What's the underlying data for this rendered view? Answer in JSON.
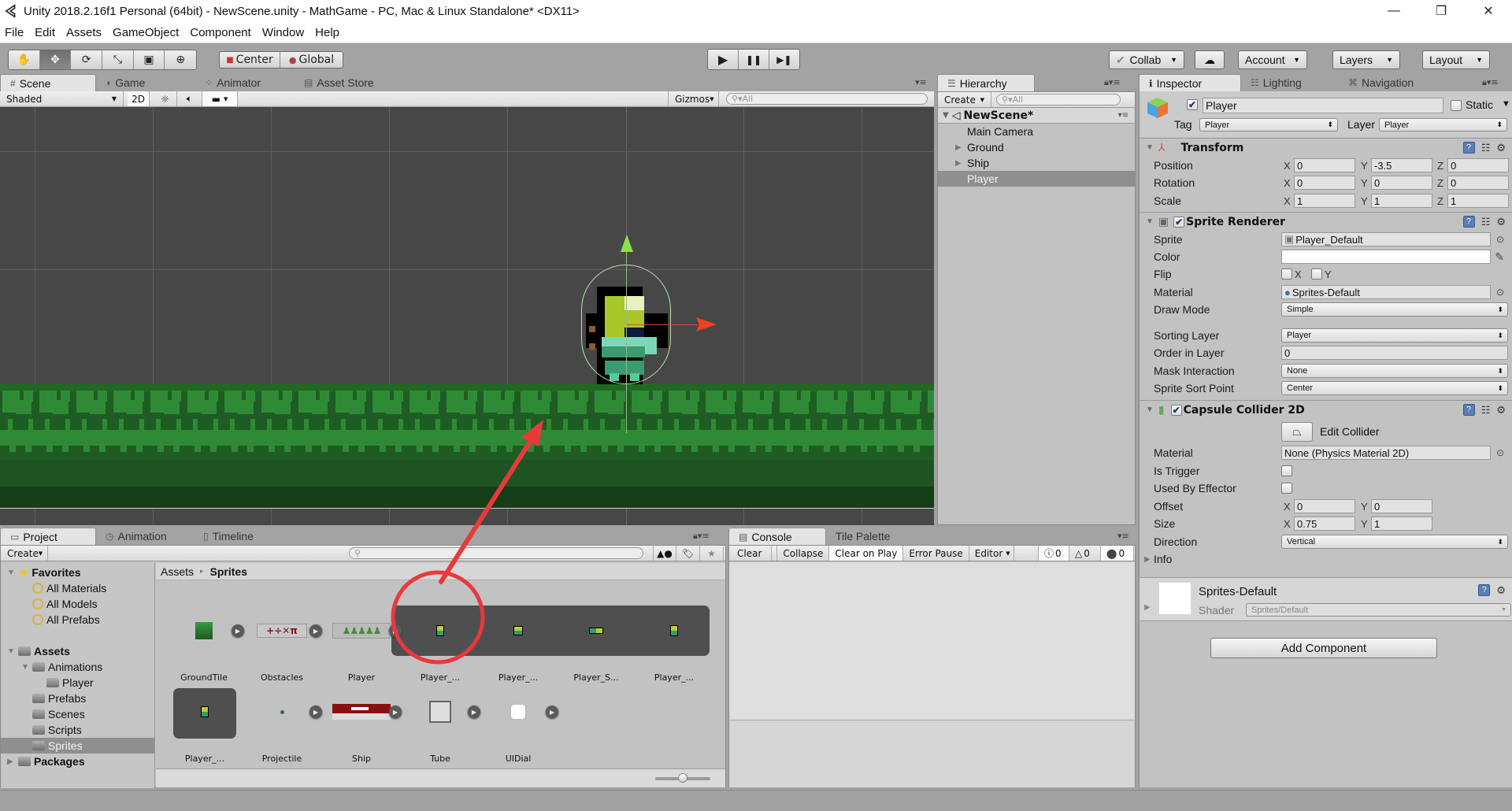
{
  "window": {
    "title": "Unity 2018.2.16f1 Personal (64bit) - NewScene.unity - MathGame - PC, Mac & Linux Standalone* <DX11>",
    "minimize": "—",
    "maximize": "❐",
    "close": "✕"
  },
  "menu": [
    "File",
    "Edit",
    "Assets",
    "GameObject",
    "Component",
    "Window",
    "Help"
  ],
  "toolbar": {
    "tools": [
      {
        "name": "hand-tool",
        "glyph": "✋",
        "active": false
      },
      {
        "name": "move-tool",
        "glyph": "✥",
        "active": true
      },
      {
        "name": "rotate-tool",
        "glyph": "⟳",
        "active": false
      },
      {
        "name": "scale-tool",
        "glyph": "⤡",
        "active": false
      },
      {
        "name": "rect-tool",
        "glyph": "▣",
        "active": false
      },
      {
        "name": "transform-tool",
        "glyph": "⊕",
        "active": false
      }
    ],
    "pivot": "Center",
    "space": "Global",
    "play": "▶",
    "pause": "❚❚",
    "step": "▶❚",
    "collab": "Collab",
    "cloud": "☁",
    "account": "Account",
    "layers": "Layers",
    "layout": "Layout"
  },
  "scene_tabs": [
    {
      "label": "Scene",
      "icon": "#",
      "active": true
    },
    {
      "label": "Game",
      "icon": "◖",
      "active": false
    },
    {
      "label": "Animator",
      "icon": "⁘",
      "active": false
    },
    {
      "label": "Asset Store",
      "icon": "▤",
      "active": false
    }
  ],
  "scene_toolbar": {
    "shading": "Shaded",
    "mode2d": "2D",
    "gizmos": "Gizmos",
    "search_placeholder": "All"
  },
  "hierarchy": {
    "tab": "Hierarchy",
    "create": "Create",
    "search_placeholder": "All",
    "scene": "NewScene*",
    "items": [
      {
        "label": "Main Camera",
        "expandable": false,
        "selected": false
      },
      {
        "label": "Ground",
        "expandable": true,
        "selected": false
      },
      {
        "label": "Ship",
        "expandable": true,
        "selected": false
      },
      {
        "label": "Player",
        "expandable": false,
        "selected": true
      }
    ]
  },
  "inspector": {
    "tabs": [
      {
        "label": "Inspector",
        "icon": "ℹ",
        "active": true
      },
      {
        "label": "Lighting",
        "icon": "☷",
        "active": false
      },
      {
        "label": "Navigation",
        "icon": "⌘",
        "active": false
      }
    ],
    "object": {
      "active": true,
      "name": "Player",
      "static_label": "Static",
      "static": false,
      "tag_label": "Tag",
      "tag": "Player",
      "layer_label": "Layer",
      "layer": "Player"
    },
    "transform": {
      "title": "Transform",
      "position": {
        "label": "Position",
        "x": "0",
        "y": "-3.5",
        "z": "0"
      },
      "rotation": {
        "label": "Rotation",
        "x": "0",
        "y": "0",
        "z": "0"
      },
      "scale": {
        "label": "Scale",
        "x": "1",
        "y": "1",
        "z": "1"
      }
    },
    "sprite_renderer": {
      "title": "Sprite Renderer",
      "enabled": true,
      "sprite_label": "Sprite",
      "sprite": "Player_Default",
      "color_label": "Color",
      "color": "#ffffff",
      "flip_label": "Flip",
      "flip_x": false,
      "flip_y": false,
      "material_label": "Material",
      "material": "Sprites-Default",
      "draw_mode_label": "Draw Mode",
      "draw_mode": "Simple",
      "sorting_layer_label": "Sorting Layer",
      "sorting_layer": "Player",
      "order_label": "Order in Layer",
      "order": "0",
      "mask_label": "Mask Interaction",
      "mask": "None",
      "sort_point_label": "Sprite Sort Point",
      "sort_point": "Center"
    },
    "capsule_collider": {
      "title": "Capsule Collider 2D",
      "enabled": true,
      "edit_collider": "Edit Collider",
      "material_label": "Material",
      "material": "None (Physics Material 2D)",
      "is_trigger_label": "Is Trigger",
      "is_trigger": false,
      "effector_label": "Used By Effector",
      "effector": false,
      "offset_label": "Offset",
      "offset": {
        "x": "0",
        "y": "0"
      },
      "size_label": "Size",
      "size": {
        "x": "0.75",
        "y": "1"
      },
      "direction_label": "Direction",
      "direction": "Vertical",
      "info_label": "Info"
    },
    "material_preview": {
      "name": "Sprites-Default",
      "shader_label": "Shader",
      "shader": "Sprites/Default"
    },
    "add_component": "Add Component"
  },
  "project": {
    "tabs": [
      {
        "label": "Project",
        "icon": "▭",
        "active": true
      },
      {
        "label": "Animation",
        "icon": "◷",
        "active": false
      },
      {
        "label": "Timeline",
        "icon": "▯",
        "active": false
      }
    ],
    "create": "Create",
    "search_placeholder": "",
    "tree": [
      {
        "label": "Favorites",
        "type": "star",
        "level": 0,
        "bold": true,
        "expanded": true
      },
      {
        "label": "All Materials",
        "type": "search",
        "level": 1
      },
      {
        "label": "All Models",
        "type": "search",
        "level": 1
      },
      {
        "label": "All Prefabs",
        "type": "search",
        "level": 1
      },
      {
        "label": "Assets",
        "type": "folder",
        "level": 0,
        "bold": true,
        "expanded": true
      },
      {
        "label": "Animations",
        "type": "folder",
        "level": 1,
        "expanded": true
      },
      {
        "label": "Player",
        "type": "folder",
        "level": 2
      },
      {
        "label": "Prefabs",
        "type": "folder",
        "level": 1
      },
      {
        "label": "Scenes",
        "type": "folder",
        "level": 1
      },
      {
        "label": "Scripts",
        "type": "folder",
        "level": 1
      },
      {
        "label": "Sprites",
        "type": "folder",
        "level": 1,
        "selected": true
      },
      {
        "label": "Packages",
        "type": "folder",
        "level": 0,
        "bold": true,
        "expanded": false
      }
    ],
    "breadcrumb": {
      "root": "Assets",
      "separator": "▸",
      "current": "Sprites"
    },
    "assets_row1": [
      {
        "label": "GroundTile",
        "kind": "groundtile"
      },
      {
        "label": "Obstacles",
        "kind": "obstacles"
      },
      {
        "label": "Player",
        "kind": "playersheet"
      },
      {
        "label": "Player_...",
        "kind": "sub-player",
        "highlighted": true
      },
      {
        "label": "Player_...",
        "kind": "sub-player2"
      },
      {
        "label": "Player_S...",
        "kind": "sub-slide"
      },
      {
        "label": "Player_...",
        "kind": "sub-player3"
      }
    ],
    "assets_row2": [
      {
        "label": "Player_...",
        "kind": "sub-player-single"
      },
      {
        "label": "Projectile",
        "kind": "projectile"
      },
      {
        "label": "Ship",
        "kind": "ship"
      },
      {
        "label": "Tube",
        "kind": "tube"
      },
      {
        "label": "UIDial",
        "kind": "uidial"
      }
    ],
    "zoom_slider": 0.5
  },
  "console": {
    "tabs": [
      {
        "label": "Console",
        "icon": "▤",
        "active": true
      },
      {
        "label": "Tile Palette",
        "icon": "",
        "active": false
      }
    ],
    "buttons": [
      "Clear",
      "Collapse",
      "Clear on Play",
      "Error Pause",
      "Editor"
    ],
    "active_buttons": [
      "Clear on Play"
    ],
    "counts": {
      "info": "0",
      "warning": "0",
      "error": "0"
    }
  },
  "annotation": {
    "color": "#e8393b",
    "description": "red circle around Player_ sprite with arrow pointing to the ground in scene view"
  }
}
